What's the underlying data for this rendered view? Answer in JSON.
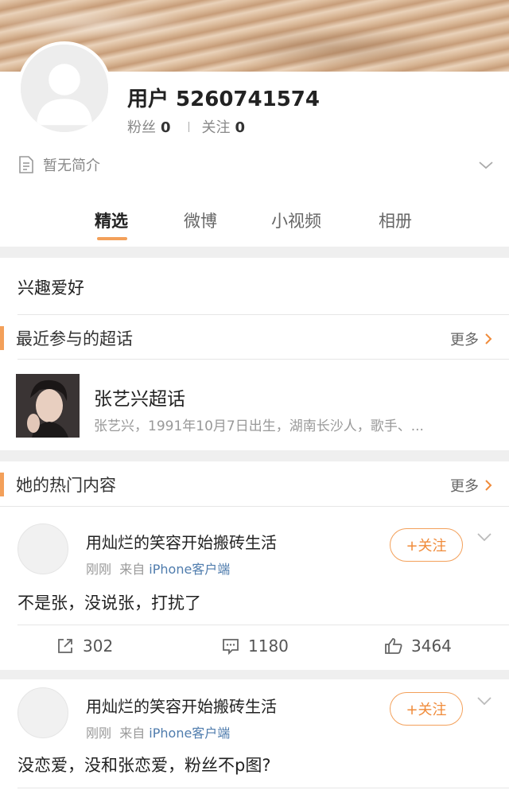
{
  "profile": {
    "username": "用户 5260741574",
    "fans_label": "粉丝",
    "fans_count": "0",
    "following_label": "关注",
    "following_count": "0",
    "bio": "暂无简介"
  },
  "tabs": [
    {
      "label": "精选"
    },
    {
      "label": "微博"
    },
    {
      "label": "小视频"
    },
    {
      "label": "相册"
    }
  ],
  "interests": {
    "title": "兴趣爱好"
  },
  "super_topics": {
    "header": "最近参与的超话",
    "more": "更多",
    "topic_name": "张艺兴超话",
    "topic_desc": "张艺兴，1991年10月7日出生，湖南长沙人，歌手、..."
  },
  "hot_content": {
    "header": "她的热门内容",
    "more": "更多",
    "posts": [
      {
        "author": "用灿烂的笑容开始搬砖生活",
        "time": "刚刚",
        "from_label": "来自",
        "source": "iPhone客户端",
        "follow_label": "+关注",
        "text": "不是张，没说张，打扰了",
        "reposts": "302",
        "comments": "1180",
        "likes": "3464"
      },
      {
        "author": "用灿烂的笑容开始搬砖生活",
        "time": "刚刚",
        "from_label": "来自",
        "source": "iPhone客户端",
        "follow_label": "+关注",
        "text": "没恋爱，没和张恋爱，粉丝不p图?"
      }
    ]
  },
  "colors": {
    "accent": "#f3a05a",
    "link": "#4f7cad"
  }
}
